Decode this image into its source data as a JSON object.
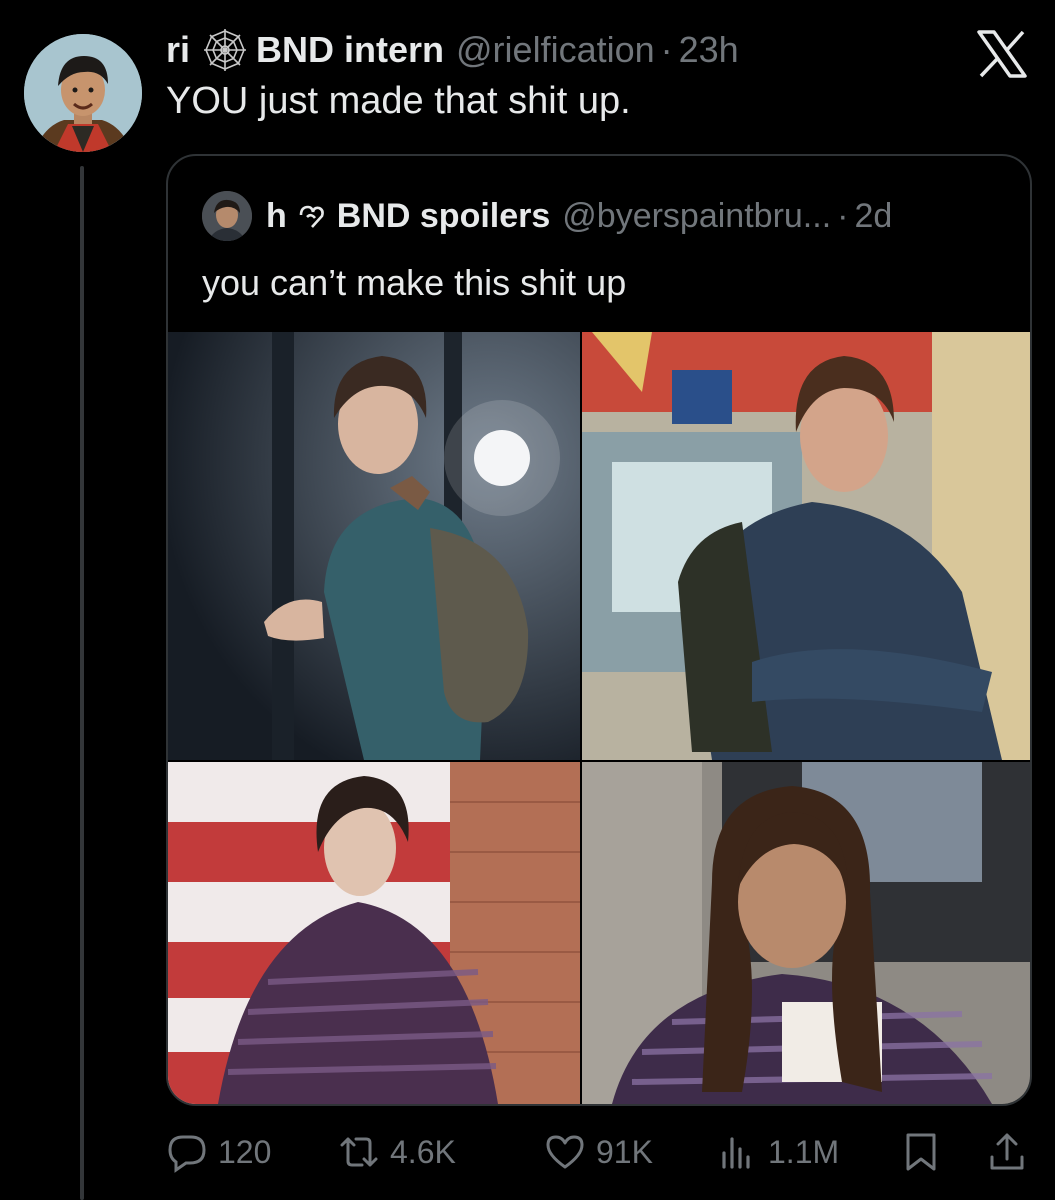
{
  "tweet": {
    "display_name": "ri",
    "badge_text": "BND intern",
    "handle": "@rielfication",
    "separator": "·",
    "time": "23h",
    "text": "YOU just made that shit up."
  },
  "quoted_tweet": {
    "display_name": "h",
    "badge_text": "BND spoilers",
    "handle": "@byerspaintbru...",
    "separator": "·",
    "time": "2d",
    "text": "you can’t make this shit up",
    "images": [
      "photo-1",
      "photo-2",
      "photo-3",
      "photo-4"
    ]
  },
  "actions": {
    "replies": "120",
    "retweets": "4.6K",
    "likes": "91K",
    "views": "1.1M"
  },
  "colors": {
    "background": "#000000",
    "text_primary": "#e7e9ea",
    "text_secondary": "#71767b",
    "border": "#2f3336"
  },
  "icons": [
    "spiderweb-icon",
    "x-logo-icon",
    "heart-outline-icon",
    "reply-icon",
    "retweet-icon",
    "like-icon",
    "views-icon",
    "bookmark-icon",
    "share-icon"
  ]
}
